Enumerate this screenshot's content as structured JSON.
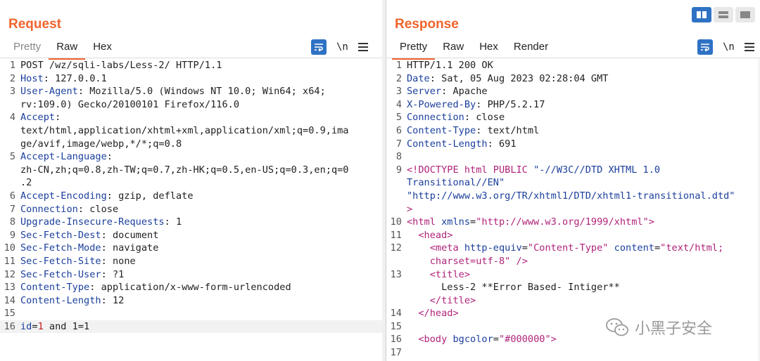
{
  "request": {
    "title": "Request",
    "tabs": [
      "Pretty",
      "Raw",
      "Hex"
    ],
    "active_tab": "Raw",
    "newline_toggle": "\\n",
    "lines": [
      {
        "n": "1",
        "segs": [
          {
            "t": "POST /wz/sqli-labs/Less-2/ HTTP/1.1",
            "c": ""
          }
        ]
      },
      {
        "n": "2",
        "segs": [
          {
            "t": "Host",
            "c": "k"
          },
          {
            "t": ": 127.0.0.1",
            "c": ""
          }
        ]
      },
      {
        "n": "3",
        "segs": [
          {
            "t": "User-Agent",
            "c": "k"
          },
          {
            "t": ": Mozilla/5.0 (Windows NT 10.0; Win64; x64;",
            "c": ""
          }
        ]
      },
      {
        "n": "",
        "segs": [
          {
            "t": "rv:109.0) Gecko/20100101 Firefox/116.0",
            "c": ""
          }
        ]
      },
      {
        "n": "4",
        "segs": [
          {
            "t": "Accept",
            "c": "k"
          },
          {
            "t": ":",
            "c": ""
          }
        ]
      },
      {
        "n": "",
        "segs": [
          {
            "t": "text/html,application/xhtml+xml,application/xml;q=0.9,ima",
            "c": ""
          }
        ]
      },
      {
        "n": "",
        "segs": [
          {
            "t": "ge/avif,image/webp,*/*;q=0.8",
            "c": ""
          }
        ]
      },
      {
        "n": "5",
        "segs": [
          {
            "t": "Accept-Language",
            "c": "k"
          },
          {
            "t": ":",
            "c": ""
          }
        ]
      },
      {
        "n": "",
        "segs": [
          {
            "t": "zh-CN,zh;q=0.8,zh-TW;q=0.7,zh-HK;q=0.5,en-US;q=0.3,en;q=0",
            "c": ""
          }
        ]
      },
      {
        "n": "",
        "segs": [
          {
            "t": ".2",
            "c": ""
          }
        ]
      },
      {
        "n": "6",
        "segs": [
          {
            "t": "Accept-Encoding",
            "c": "k"
          },
          {
            "t": ": gzip, deflate",
            "c": ""
          }
        ]
      },
      {
        "n": "7",
        "segs": [
          {
            "t": "Connection",
            "c": "k"
          },
          {
            "t": ": close",
            "c": ""
          }
        ]
      },
      {
        "n": "8",
        "segs": [
          {
            "t": "Upgrade-Insecure-Requests",
            "c": "k"
          },
          {
            "t": ": 1",
            "c": ""
          }
        ]
      },
      {
        "n": "9",
        "segs": [
          {
            "t": "Sec-Fetch-Dest",
            "c": "k"
          },
          {
            "t": ": document",
            "c": ""
          }
        ]
      },
      {
        "n": "10",
        "segs": [
          {
            "t": "Sec-Fetch-Mode",
            "c": "k"
          },
          {
            "t": ": navigate",
            "c": ""
          }
        ]
      },
      {
        "n": "11",
        "segs": [
          {
            "t": "Sec-Fetch-Site",
            "c": "k"
          },
          {
            "t": ": none",
            "c": ""
          }
        ]
      },
      {
        "n": "12",
        "segs": [
          {
            "t": "Sec-Fetch-User",
            "c": "k"
          },
          {
            "t": ": ?1",
            "c": ""
          }
        ]
      },
      {
        "n": "13",
        "segs": [
          {
            "t": "Content-Type",
            "c": "k"
          },
          {
            "t": ": application/x-www-form-urlencoded",
            "c": ""
          }
        ]
      },
      {
        "n": "14",
        "segs": [
          {
            "t": "Content-Length",
            "c": "k"
          },
          {
            "t": ": 12",
            "c": ""
          }
        ]
      },
      {
        "n": "15",
        "segs": [
          {
            "t": "",
            "c": ""
          }
        ]
      },
      {
        "n": "16",
        "hl": true,
        "segs": [
          {
            "t": "id",
            "c": "k"
          },
          {
            "t": "=",
            "c": ""
          },
          {
            "t": "1",
            "c": "red"
          },
          {
            "t": " and 1=1",
            "c": ""
          }
        ]
      }
    ]
  },
  "response": {
    "title": "Response",
    "tabs": [
      "Pretty",
      "Raw",
      "Hex",
      "Render"
    ],
    "active_tab": "Pretty",
    "newline_toggle": "\\n",
    "lines": [
      {
        "n": "1",
        "segs": [
          {
            "t": "HTTP/1.1 200 OK",
            "c": ""
          }
        ]
      },
      {
        "n": "2",
        "segs": [
          {
            "t": "Date",
            "c": "k"
          },
          {
            "t": ": Sat, 05 Aug 2023 02:28:04 GMT",
            "c": ""
          }
        ]
      },
      {
        "n": "3",
        "segs": [
          {
            "t": "Server",
            "c": "k"
          },
          {
            "t": ": Apache",
            "c": ""
          }
        ]
      },
      {
        "n": "4",
        "segs": [
          {
            "t": "X-Powered-By",
            "c": "k"
          },
          {
            "t": ": PHP/5.2.17",
            "c": ""
          }
        ]
      },
      {
        "n": "5",
        "segs": [
          {
            "t": "Connection",
            "c": "k"
          },
          {
            "t": ": close",
            "c": ""
          }
        ]
      },
      {
        "n": "6",
        "segs": [
          {
            "t": "Content-Type",
            "c": "k"
          },
          {
            "t": ": text/html",
            "c": ""
          }
        ]
      },
      {
        "n": "7",
        "segs": [
          {
            "t": "Content-Length",
            "c": "k"
          },
          {
            "t": ": 691",
            "c": ""
          }
        ]
      },
      {
        "n": "8",
        "segs": [
          {
            "t": "",
            "c": ""
          }
        ]
      },
      {
        "n": "9",
        "segs": [
          {
            "t": "<!DOCTYPE html PUBLIC ",
            "c": "tag"
          },
          {
            "t": "\"-//W3C//DTD XHTML 1.0",
            "c": "str"
          }
        ]
      },
      {
        "n": "",
        "segs": [
          {
            "t": "Transitional//EN\"",
            "c": "str"
          }
        ]
      },
      {
        "n": "",
        "segs": [
          {
            "t": "\"http://www.w3.org/TR/xhtml1/DTD/xhtml1-transitional.dtd\"",
            "c": "str"
          }
        ]
      },
      {
        "n": "",
        "segs": [
          {
            "t": ">",
            "c": "tag"
          }
        ]
      },
      {
        "n": "10",
        "segs": [
          {
            "t": "<html ",
            "c": "tag"
          },
          {
            "t": "xmlns",
            "c": "attr"
          },
          {
            "t": "=",
            "c": ""
          },
          {
            "t": "\"http://www.w3.org/1999/xhtml\"",
            "c": "tag"
          },
          {
            "t": ">",
            "c": "tag"
          }
        ]
      },
      {
        "n": "11",
        "segs": [
          {
            "t": "  ",
            "c": ""
          },
          {
            "t": "<head>",
            "c": "tag"
          }
        ]
      },
      {
        "n": "12",
        "segs": [
          {
            "t": "    ",
            "c": ""
          },
          {
            "t": "<meta ",
            "c": "tag"
          },
          {
            "t": "http-equiv",
            "c": "attr"
          },
          {
            "t": "=",
            "c": ""
          },
          {
            "t": "\"Content-Type\"",
            "c": "tag"
          },
          {
            "t": " content",
            "c": "attr"
          },
          {
            "t": "=",
            "c": ""
          },
          {
            "t": "\"text/html;",
            "c": "tag"
          }
        ]
      },
      {
        "n": "",
        "segs": [
          {
            "t": "    ",
            "c": ""
          },
          {
            "t": "charset=utf-8\"",
            "c": "tag"
          },
          {
            "t": " />",
            "c": "tag"
          }
        ]
      },
      {
        "n": "13",
        "segs": [
          {
            "t": "    ",
            "c": ""
          },
          {
            "t": "<title>",
            "c": "tag"
          }
        ]
      },
      {
        "n": "",
        "segs": [
          {
            "t": "      Less-2 **Error Based- Intiger**",
            "c": ""
          }
        ]
      },
      {
        "n": "",
        "segs": [
          {
            "t": "    ",
            "c": ""
          },
          {
            "t": "</title>",
            "c": "tag"
          }
        ]
      },
      {
        "n": "14",
        "segs": [
          {
            "t": "  ",
            "c": ""
          },
          {
            "t": "</head>",
            "c": "tag"
          }
        ]
      },
      {
        "n": "15",
        "segs": [
          {
            "t": "",
            "c": ""
          }
        ]
      },
      {
        "n": "16",
        "segs": [
          {
            "t": "  ",
            "c": ""
          },
          {
            "t": "<body ",
            "c": "tag"
          },
          {
            "t": "bgcolor",
            "c": "attr"
          },
          {
            "t": "=",
            "c": ""
          },
          {
            "t": "\"#000000\"",
            "c": "tag"
          },
          {
            "t": ">",
            "c": "tag"
          }
        ]
      },
      {
        "n": "17",
        "segs": [
          {
            "t": "",
            "c": ""
          }
        ]
      }
    ]
  },
  "watermark": {
    "text": "小黑子安全",
    "icon": "wechat-icon"
  },
  "colors": {
    "accent": "#f0642c",
    "header_key": "#1a3f9c",
    "tag": "#b0237a",
    "button": "#2f72c4"
  }
}
